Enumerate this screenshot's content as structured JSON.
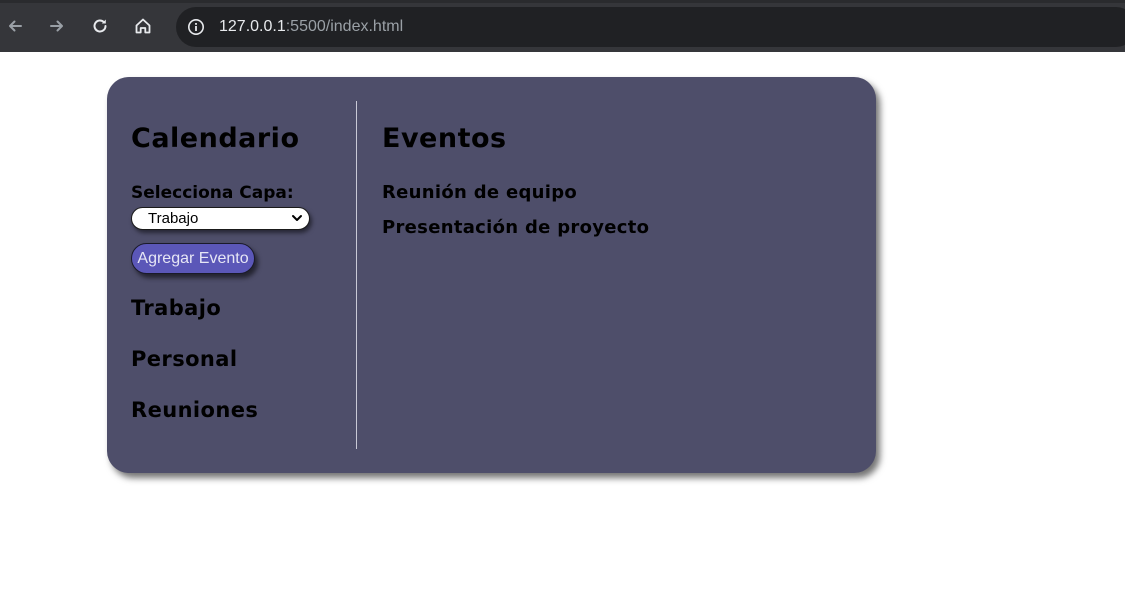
{
  "browser": {
    "url_host": "127.0.0.1",
    "url_path": ":5500/index.html",
    "icons": {
      "back": "arrow-left-icon",
      "forward": "arrow-right-icon",
      "reload": "reload-icon",
      "home": "home-icon",
      "info": "info-icon"
    }
  },
  "sidebar": {
    "title": "Calendario",
    "select_label": "Selecciona Capa:",
    "select_value": "Trabajo",
    "add_button": "Agregar Evento",
    "layers": [
      "Trabajo",
      "Personal",
      "Reuniones"
    ]
  },
  "main": {
    "title": "Eventos",
    "events": [
      "Reunión de equipo",
      "Presentación de proyecto"
    ]
  },
  "colors": {
    "panel_bg": "#4e4e6a",
    "button_bg": "#5b57b8",
    "browser_bar": "#35363a",
    "omnibox": "#202124"
  }
}
